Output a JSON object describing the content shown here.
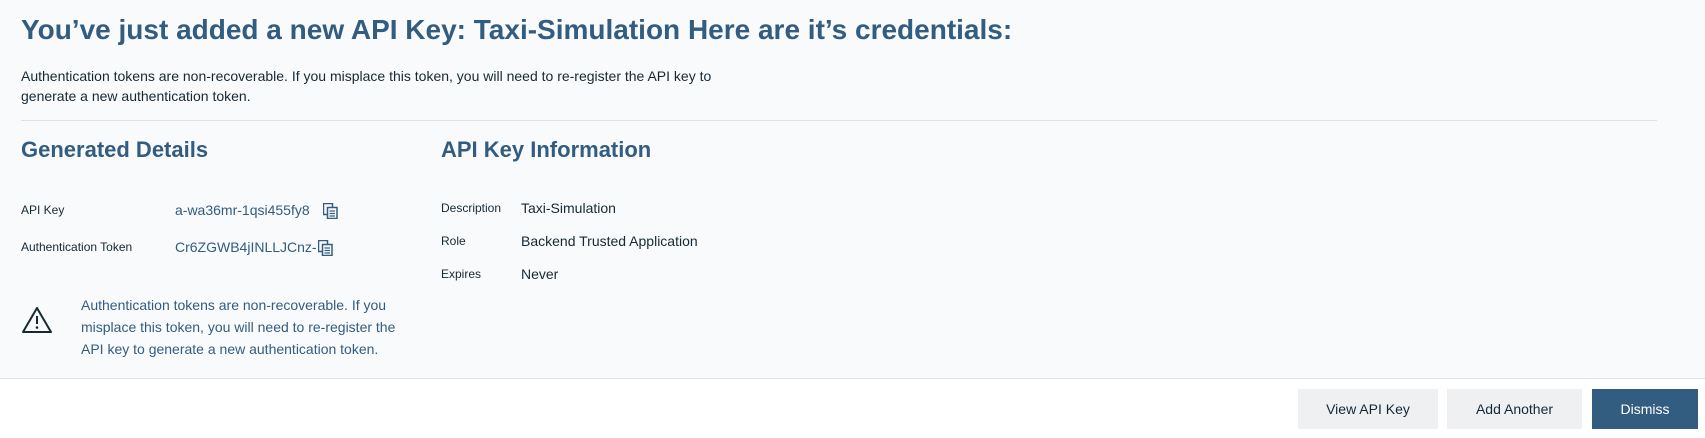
{
  "header": {
    "title": "You’ve just added a new API Key: Taxi-Simulation Here are it’s credentials:",
    "intro": "Authentication tokens are non-recoverable. If you misplace this token, you will need to re-register the API key to generate a new authentication token."
  },
  "generated": {
    "title": "Generated Details",
    "api_key_label": "API Key",
    "api_key_value": "a-wa36mr-1qsi455fy8",
    "token_label": "Authentication Token",
    "token_value": "Cr6ZGWB4jINLLJCnz-",
    "copy_icon": "copy-icon",
    "warning_icon": "warning-triangle-icon",
    "warning_text": "Authentication tokens are non-recoverable. If you misplace this token, you will need to re-register the API key to generate a new authentication token."
  },
  "info": {
    "title": "API Key Information",
    "description_label": "Description",
    "description_value": "Taxi-Simulation",
    "role_label": "Role",
    "role_value": "Backend Trusted Application",
    "expires_label": "Expires",
    "expires_value": "Never"
  },
  "actions": {
    "view_label": "View API Key",
    "add_label": "Add Another",
    "dismiss_label": "Dismiss"
  },
  "colors": {
    "accent": "#325c80",
    "panel_bg": "#f9fafb",
    "secondary_button_bg": "#eef0f2"
  }
}
